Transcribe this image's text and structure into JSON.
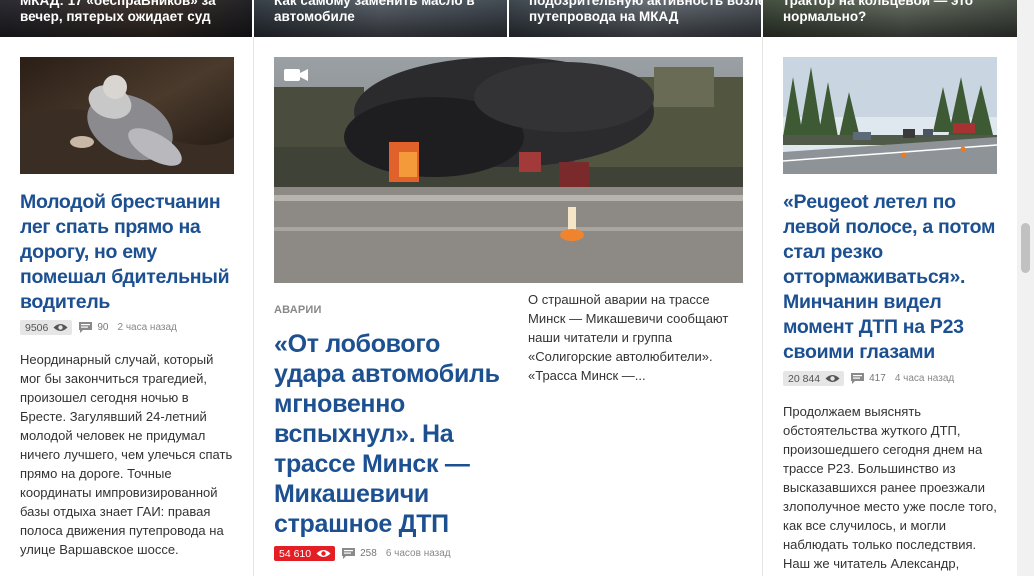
{
  "top_strip": [
    {
      "line1": "МКАД: 17 «беспраВников» за",
      "line2": "вечер, пятерых ожидает суд"
    },
    {
      "line1": "Как самому заменить масло в",
      "line2": "автомобиле"
    },
    {
      "line1": "подозрительную активность возле",
      "line2": "путепровода на МКАД"
    },
    {
      "line1": "трактор на кольцевой — это",
      "line2": "нормально?"
    }
  ],
  "left_article": {
    "headline": "Молодой брестчанин лег спать прямо на дорогу, но ему помешал бдительный водитель",
    "views": "9506",
    "comments": "90",
    "time": "2 часа назад",
    "lead": "Неординарный случай, который мог бы закончиться трагедией, произошел сегодня ночью в Бресте. Загулявший 24-летний молодой человек не придумал ничего лучшего, чем улечься спать прямо на дороге. Точные координаты импровизированной базы отдыха знает ГАИ: правая полоса движения путепровода на улице Варшавское шоссе."
  },
  "center_article": {
    "media_icon": "video-camera-icon",
    "rubric": "АВАРИИ",
    "headline": "«От лобового удара автомобиль мгновенно вспыхнул». На трассе Минск — Микашевичи страшное ДТП",
    "views": "54 610",
    "comments": "258",
    "time": "6 часов назад",
    "lead": "О страшной аварии на трассе Минск — Микашевичи сообщают наши читатели и группа «Солигорские автолюбители». «Трасса Минск —..."
  },
  "right_article": {
    "headline": "«Peugeot летел по левой полосе, а потом стал резко оттормаживаться». Минчанин видел момент ДТП на Р23 своими глазами",
    "views": "20 844",
    "comments": "417",
    "time": "4 часа назад",
    "lead": "Продолжаем выяснять обстоятельства жуткого ДТП, произошедшего сегодня днем на трассе Р23. Большинство из высказавшихся ранее проезжали злополучное место уже после того, как все случилось, и могли наблюдать только последствия. Наш же читатель Александр,"
  },
  "colors": {
    "headline": "#1c5091",
    "hot_badge": "#e31e24",
    "views_badge": "#e6e6e6"
  }
}
